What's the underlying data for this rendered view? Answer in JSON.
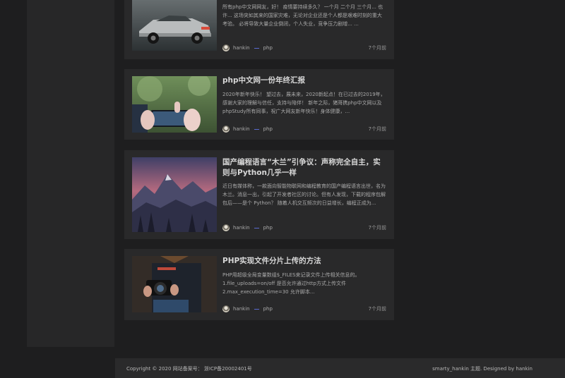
{
  "posts": [
    {
      "title": "",
      "excerpt": "所有php中文网网友，好！ 疫情要持续多久？ 一个月 二个月 三个月... 也许... 这场突如其来的国家灾难，无论对企业还是个人都是艰难时刻的重大考验。 必将导致大量企业倒闭，个人失业，竞争压力剧增... ...",
      "author": "hankin",
      "category": "php",
      "time": "7个月前",
      "image": "car-photo"
    },
    {
      "title": "php中文网一份年终汇报",
      "excerpt": "2020年新年快乐！ 望过去，展未来，2020新起点！在已过去的2019年，感谢大家的理解与信任，支持与陪伴！ 新年之际，猪哥携php中文网以及phpStudy所有同事，祝广大网友新年快乐！身体健康，...",
      "author": "hankin",
      "category": "php",
      "time": "7个月前",
      "image": "phone-photo"
    },
    {
      "title": "国产编程语言“木兰”引争议：声称完全自主，实则与Python几乎一样",
      "excerpt": "近日有媒体称，一款面向智能物联网和编程教育的国产编程语言出世，名为木兰。消息一出，引起了开发者社区的讨论。但有人发现，下载的程序包解包后——是个 Python？ 随着人机交互频次的日益增长，编程正成为...",
      "author": "hankin",
      "category": "php",
      "time": "7个月前",
      "image": "mountain-photo"
    },
    {
      "title": "PHP实现文件分片上传的方法",
      "excerpt": "PHP用超级全局变量数组$_FILES来记录文件上传相关信息的。 1.file_uploads=on/off 是否允许通过http方式上传文件 2.max_execution_time=30 允许脚本...",
      "author": "hankin",
      "category": "php",
      "time": "7个月前",
      "image": "camera-photo"
    }
  ],
  "footer": {
    "copyright": "Copyright © 2020 网站备案号： 浙ICP备20002401号",
    "credit": "smarty_hankin 主题. Designed by hankin"
  }
}
